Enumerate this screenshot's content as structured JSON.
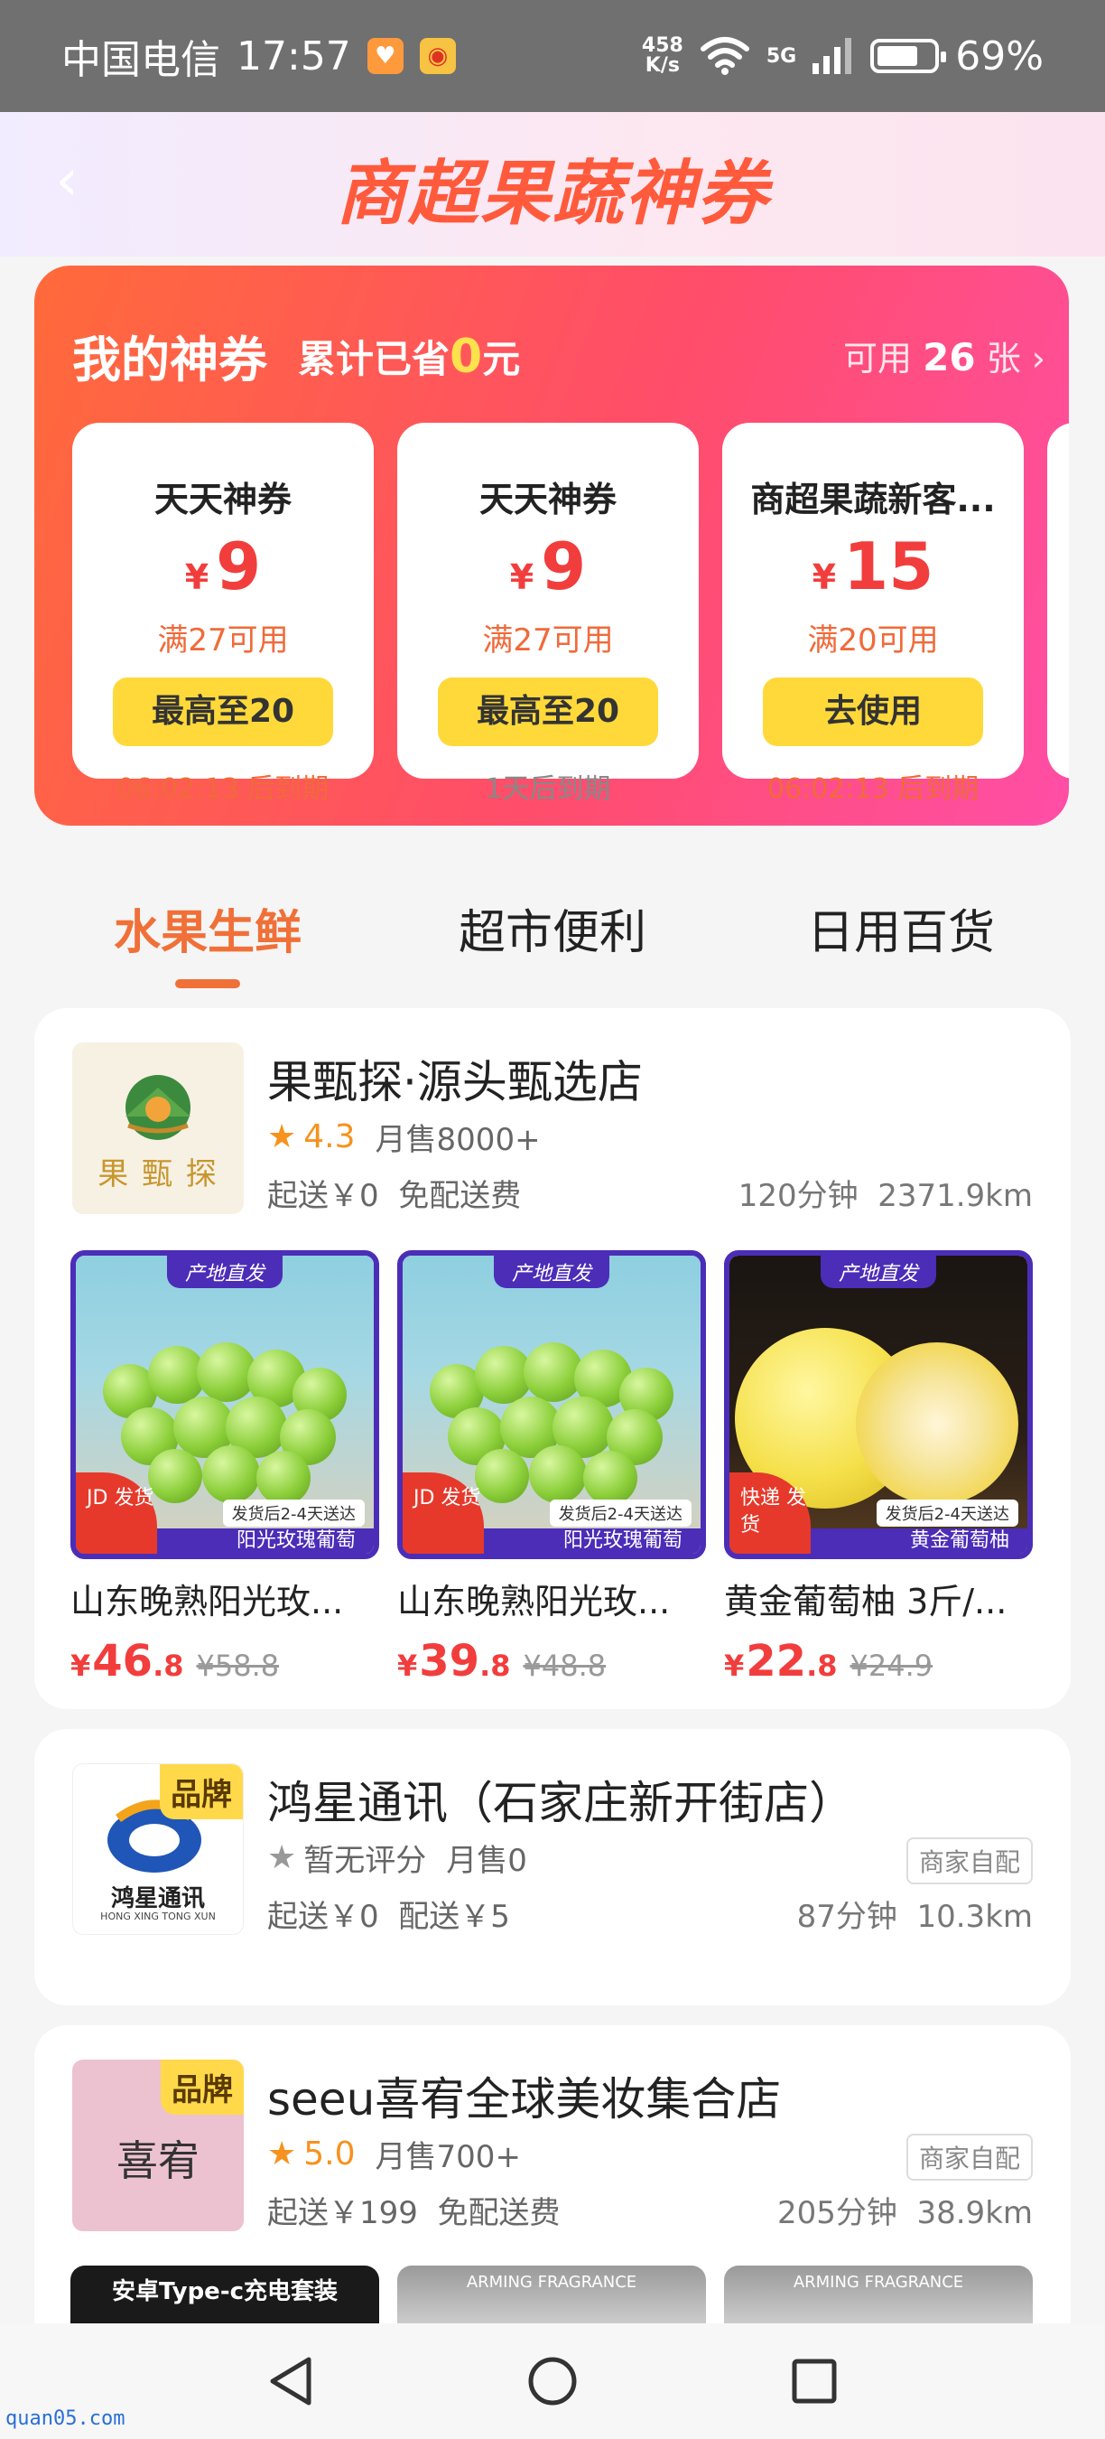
{
  "status_bar": {
    "carrier": "中国电信",
    "time": "17:57",
    "net_speed_value": "458",
    "net_speed_unit": "K/s",
    "network": "5G",
    "battery": "69%"
  },
  "header": {
    "title": "商超果蔬神券"
  },
  "coupons": {
    "title": "我的神券",
    "saved_prefix": "累计已省",
    "saved_amount": "0",
    "saved_suffix": "元",
    "available_prefix": "可用",
    "available_count": "26",
    "available_suffix": "张",
    "items": [
      {
        "name": "天天神券",
        "currency": "¥",
        "amount": "9",
        "condition": "满27可用",
        "button": "最高至20",
        "expiry": "06:02:13 后到期"
      },
      {
        "name": "天天神券",
        "currency": "¥",
        "amount": "9",
        "condition": "满27可用",
        "button": "最高至20",
        "expiry": "1天后到期"
      },
      {
        "name": "商超果蔬新客...",
        "currency": "¥",
        "amount": "15",
        "condition": "满20可用",
        "button": "去使用",
        "expiry": "06:02:13 后到期"
      }
    ]
  },
  "tabs": [
    {
      "label": "水果生鲜",
      "active": true
    },
    {
      "label": "超市便利",
      "active": false
    },
    {
      "label": "日用百货",
      "active": false
    }
  ],
  "stores": [
    {
      "name": "果甄探·源头甄选店",
      "logo_text": "果 甄 探",
      "rating": "4.3",
      "monthly_sales": "月售8000+",
      "min_order": "起送￥0",
      "delivery_fee": "免配送费",
      "time": "120分钟",
      "distance": "2371.9km",
      "products": [
        {
          "tag": "产地直发",
          "corner": "JD 发货",
          "note": "发货后2-4天送达",
          "variety": "阳光玫瑰葡萄",
          "name": "山东晚熟阳光玫...",
          "currency": "¥",
          "price_int": "46",
          "price_dec": ".8",
          "orig": "¥58.8"
        },
        {
          "tag": "产地直发",
          "corner": "JD 发货",
          "note": "发货后2-4天送达",
          "variety": "阳光玫瑰葡萄",
          "name": "山东晚熟阳光玫...",
          "currency": "¥",
          "price_int": "39",
          "price_dec": ".8",
          "orig": "¥48.8"
        },
        {
          "tag": "产地直发",
          "corner": "快递 发货",
          "note": "发货后2-4天送达",
          "variety": "黄金葡萄柚",
          "name": "黄金葡萄柚 3斤/...",
          "currency": "¥",
          "price_int": "22",
          "price_dec": ".8",
          "orig": "¥24.9"
        }
      ]
    },
    {
      "name": "鸿星通讯（石家庄新开街店）",
      "brand_tag": "品牌",
      "logo_text": "鸿星通讯",
      "logo_sub": "HONG XING TONG XUN",
      "rating": "暂无评分",
      "monthly_sales": "月售0",
      "self_delivery": "商家自配",
      "min_order": "起送￥0",
      "delivery_fee": "配送￥5",
      "time": "87分钟",
      "distance": "10.3km"
    },
    {
      "name": "seeu喜宥全球美妆集合店",
      "brand_tag": "品牌",
      "logo_text": "喜宥",
      "rating": "5.0",
      "monthly_sales": "月售700+",
      "self_delivery": "商家自配",
      "min_order": "起送￥199",
      "delivery_fee": "免配送费",
      "time": "205分钟",
      "distance": "38.9km",
      "thumbs": [
        {
          "label": "安卓Type-c充电套装"
        },
        {
          "label": "ARMING FRAGRANCE"
        },
        {
          "label": "ARMING FRAGRANCE"
        }
      ]
    }
  ],
  "watermark": "quan05.com",
  "colors": {
    "accent": "#f07038",
    "price": "#f23d3d",
    "coupon_button": "#ffd93a"
  }
}
